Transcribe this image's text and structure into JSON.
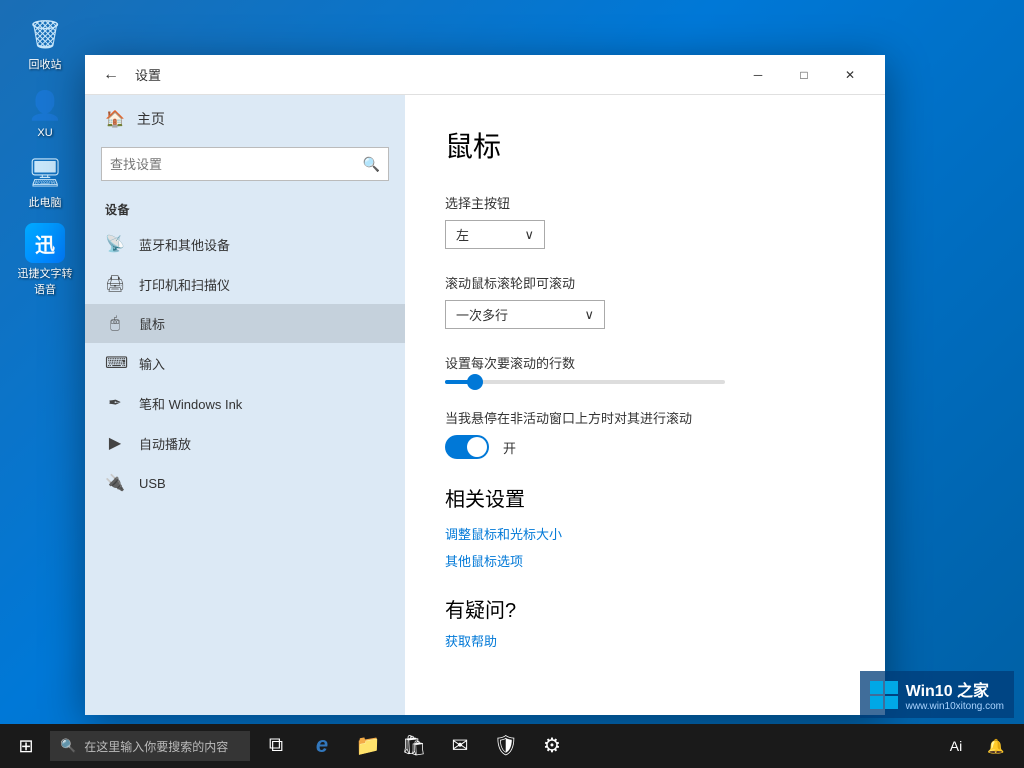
{
  "desktop": {
    "icons": [
      {
        "id": "recycle-bin",
        "label": "回收站",
        "symbol": "🗑"
      },
      {
        "id": "user-folder",
        "label": "XU",
        "symbol": "👤"
      },
      {
        "id": "this-computer",
        "label": "此电脑",
        "symbol": "🖥"
      },
      {
        "id": "app-ocr",
        "label": "迅捷文字转语音",
        "symbol": "迅"
      }
    ]
  },
  "window": {
    "title": "设置",
    "back_label": "←",
    "min_label": "─",
    "max_label": "□",
    "close_label": "✕"
  },
  "sidebar": {
    "home_label": "主页",
    "search_placeholder": "查找设置",
    "section_label": "设备",
    "nav_items": [
      {
        "id": "bluetooth",
        "label": "蓝牙和其他设备",
        "icon": "📡"
      },
      {
        "id": "printer",
        "label": "打印机和扫描仪",
        "icon": "🖨"
      },
      {
        "id": "mouse",
        "label": "鼠标",
        "icon": "🖱",
        "active": true
      },
      {
        "id": "input",
        "label": "输入",
        "icon": "⌨"
      },
      {
        "id": "pen",
        "label": "笔和 Windows Ink",
        "icon": "✒"
      },
      {
        "id": "autoplay",
        "label": "自动播放",
        "icon": "▶"
      },
      {
        "id": "usb",
        "label": "USB",
        "icon": "🔌"
      }
    ]
  },
  "content": {
    "page_title": "鼠标",
    "primary_button_label": "选择主按钮",
    "primary_button_value": "左",
    "scroll_label": "滚动鼠标滚轮即可滚动",
    "scroll_value": "一次多行",
    "scroll_lines_label": "设置每次要滚动的行数",
    "inactive_scroll_label": "当我悬停在非活动窗口上方时对其进行滚动",
    "toggle_state": "开",
    "related_title": "相关设置",
    "link1": "调整鼠标和光标大小",
    "link2": "其他鼠标选项",
    "faq_title": "有疑问?",
    "faq_link": "获取帮助"
  },
  "taskbar": {
    "start_icon": "⊞",
    "search_placeholder": "在这里输入你要搜索的内容",
    "apps": [
      {
        "id": "task-view",
        "icon": "⧉"
      },
      {
        "id": "edge",
        "icon": "e"
      },
      {
        "id": "explorer",
        "icon": "📁"
      },
      {
        "id": "store",
        "icon": "🛍"
      },
      {
        "id": "mail",
        "icon": "✉"
      },
      {
        "id": "defender",
        "icon": "🛡"
      },
      {
        "id": "settings",
        "icon": "⚙"
      }
    ],
    "tray_text": "Ai"
  },
  "brand": {
    "name": "Win10 之家",
    "url": "www.win10xitong.com"
  }
}
